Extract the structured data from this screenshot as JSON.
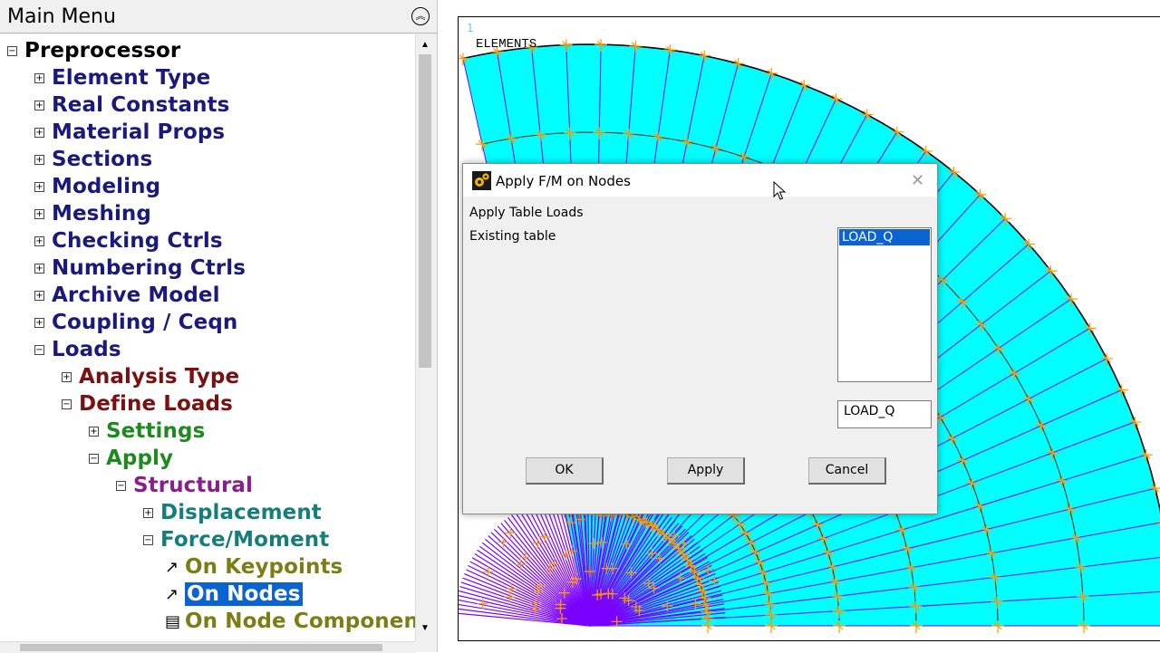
{
  "menu": {
    "title": "Main Menu",
    "collapse_icon": "double-chevron-up-icon",
    "tree": [
      {
        "label": "Preprocessor",
        "level": 0,
        "state": "expanded",
        "color": "#000000"
      },
      {
        "label": "Element Type",
        "level": 1,
        "state": "collapsed",
        "color": "#1a1a7e"
      },
      {
        "label": "Real Constants",
        "level": 1,
        "state": "collapsed",
        "color": "#1a1a7e"
      },
      {
        "label": "Material Props",
        "level": 1,
        "state": "collapsed",
        "color": "#1a1a7e"
      },
      {
        "label": "Sections",
        "level": 1,
        "state": "collapsed",
        "color": "#1a1a7e"
      },
      {
        "label": "Modeling",
        "level": 1,
        "state": "collapsed",
        "color": "#1a1a7e"
      },
      {
        "label": "Meshing",
        "level": 1,
        "state": "collapsed",
        "color": "#1a1a7e"
      },
      {
        "label": "Checking Ctrls",
        "level": 1,
        "state": "collapsed",
        "color": "#1a1a7e"
      },
      {
        "label": "Numbering Ctrls",
        "level": 1,
        "state": "collapsed",
        "color": "#1a1a7e"
      },
      {
        "label": "Archive Model",
        "level": 1,
        "state": "collapsed",
        "color": "#1a1a7e"
      },
      {
        "label": "Coupling / Ceqn",
        "level": 1,
        "state": "collapsed",
        "color": "#1a1a7e"
      },
      {
        "label": "Loads",
        "level": 1,
        "state": "expanded",
        "color": "#1a1a7e"
      },
      {
        "label": "Analysis Type",
        "level": 2,
        "state": "collapsed",
        "color": "#7a1010"
      },
      {
        "label": "Define Loads",
        "level": 2,
        "state": "expanded",
        "color": "#7a1010"
      },
      {
        "label": "Settings",
        "level": 3,
        "state": "collapsed",
        "color": "#1e8a1e"
      },
      {
        "label": "Apply",
        "level": 3,
        "state": "expanded",
        "color": "#1e8a1e"
      },
      {
        "label": "Structural",
        "level": 4,
        "state": "expanded",
        "color": "#8a1e8a"
      },
      {
        "label": "Displacement",
        "level": 5,
        "state": "collapsed",
        "color": "#167d7d"
      },
      {
        "label": "Force/Moment",
        "level": 5,
        "state": "expanded",
        "color": "#167d7d"
      },
      {
        "label": "On Keypoints",
        "level": 6,
        "state": "action",
        "icon": "arrow-pick-icon",
        "color": "#7d7d16"
      },
      {
        "label": "On Nodes",
        "level": 6,
        "state": "action",
        "icon": "arrow-pick-icon",
        "color": "#7d7d16",
        "selected": true
      },
      {
        "label": "On Node Component",
        "level": 6,
        "state": "dialog",
        "icon": "dialog-box-icon",
        "color": "#7d7d16"
      }
    ]
  },
  "graphics": {
    "window_number": "1",
    "label": "ELEMENTS",
    "mesh_fill": "#00ffff",
    "edge_color": "#7a00ff",
    "boundary_color": "#000000",
    "load_symbol_color": "#ff9900"
  },
  "dialog": {
    "title": "Apply F/M on Nodes",
    "icon": "ansys-gear-icon",
    "close_icon": "close-icon",
    "heading": "Apply Table Loads",
    "existing_label": "Existing table",
    "table_options": [
      "LOAD_Q"
    ],
    "selected_table": "LOAD_Q",
    "table_value": "LOAD_Q",
    "buttons": {
      "ok": "OK",
      "apply": "Apply",
      "cancel": "Cancel"
    }
  },
  "cursor": {
    "icon": "arrow-cursor-icon"
  }
}
